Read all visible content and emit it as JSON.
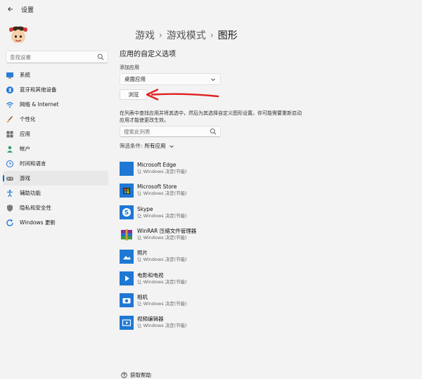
{
  "window": {
    "title": "设置"
  },
  "sidebar": {
    "search_placeholder": "查找设置",
    "items": [
      {
        "label": "系统",
        "icon": "monitor-icon",
        "active": false
      },
      {
        "label": "蓝牙和其他设备",
        "icon": "bluetooth-icon",
        "active": false
      },
      {
        "label": "网络 & Internet",
        "icon": "network-icon",
        "active": false
      },
      {
        "label": "个性化",
        "icon": "brush-icon",
        "active": false
      },
      {
        "label": "应用",
        "icon": "apps-icon",
        "active": false
      },
      {
        "label": "帐户",
        "icon": "account-icon",
        "active": false
      },
      {
        "label": "时间和语言",
        "icon": "globe-clock-icon",
        "active": false
      },
      {
        "label": "游戏",
        "icon": "gamepad-icon",
        "active": true
      },
      {
        "label": "辅助功能",
        "icon": "accessibility-icon",
        "active": false
      },
      {
        "label": "隐私和安全性",
        "icon": "shield-icon",
        "active": false
      },
      {
        "label": "Windows 更新",
        "icon": "update-icon",
        "active": false
      }
    ]
  },
  "breadcrumb": [
    "游戏",
    "游戏模式",
    "图形"
  ],
  "main": {
    "section_title": "应用的自定义选项",
    "add_app_label": "添加应用",
    "dropdown_value": "桌面应用",
    "browse_label": "浏览",
    "description": "在列表中查找应用并将其选中，然后为其选择自定义图形设置。你可能需要重新启动应用才能使更改生效。",
    "list_search_placeholder": "搜索此列表",
    "filter_label": "筛选条件:",
    "filter_value": "所有应用",
    "apps": [
      {
        "name": "Microsoft Edge",
        "status": "让 Windows 决定(节能)",
        "icon": "edge-icon"
      },
      {
        "name": "Microsoft Store",
        "status": "让 Windows 决定(节能)",
        "icon": "store-icon"
      },
      {
        "name": "Skype",
        "status": "让 Windows 决定(节能)",
        "icon": "skype-icon"
      },
      {
        "name": "WinRAR 压缩文件管理器",
        "status": "让 Windows 决定(节能)",
        "icon": "winrar-icon"
      },
      {
        "name": "照片",
        "status": "让 Windows 决定(节能)",
        "icon": "photos-icon"
      },
      {
        "name": "电影和电视",
        "status": "让 Windows 决定(节能)",
        "icon": "movies-icon"
      },
      {
        "name": "相机",
        "status": "让 Windows 决定(节能)",
        "icon": "camera-icon"
      },
      {
        "name": "视频编辑器",
        "status": "让 Windows 决定(节能)",
        "icon": "video-editor-icon"
      }
    ],
    "help_label": "获取帮助"
  },
  "colors": {
    "accent": "#0067c0",
    "annotation_arrow": "#e02020",
    "tile_blue": "#1e78d4"
  }
}
